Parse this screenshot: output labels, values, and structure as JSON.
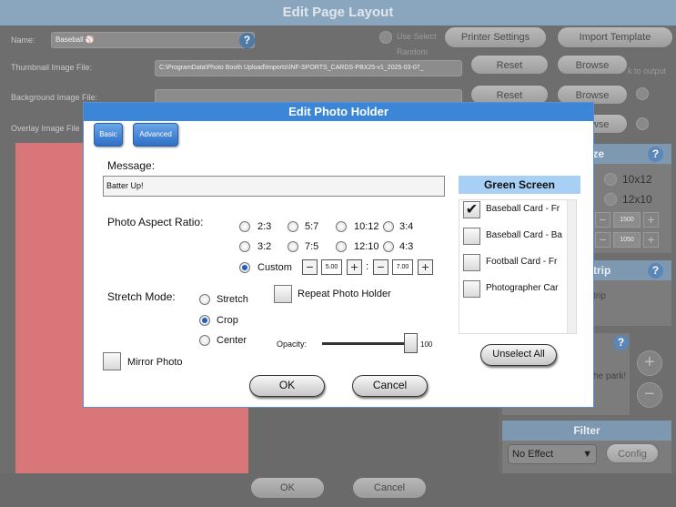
{
  "window": {
    "title": "Edit Page Layout"
  },
  "background": {
    "name_label": "Name:",
    "name_value": "Baseball",
    "thumbnail_label": "Thumbnail Image File:",
    "thumbnail_value": "C:\\ProgramData\\Photo Booth Upload\\Imports\\INF-SPORTS_CARDS-PBX25-v1_2025-03-07_",
    "background_label": "Background Image File:",
    "overlay_label": "Overlay Image File",
    "use_select": "Use Select",
    "random": "Random",
    "to_output": "k to output",
    "printer_settings": "Printer Settings",
    "import_template": "Import Template",
    "reset": "Reset",
    "browse": "Browse",
    "size_header": "ize",
    "size_10x12": "10x12",
    "size_12x10": "12x10",
    "width_value": "1500",
    "height_value": "1050",
    "strip_header": "trip",
    "strip_text": "trip",
    "msg_text": "he park!",
    "filter_header": "Filter",
    "filter_value": "No Effect",
    "config": "Config",
    "ok": "OK",
    "cancel": "Cancel",
    "plus": "+",
    "minus": "−"
  },
  "dialog": {
    "title": "Edit Photo Holder",
    "tabs": {
      "basic": "Basic",
      "advanced": "Advanced"
    },
    "message_label": "Message:",
    "message_value": "Batter Up!",
    "aspect_label": "Photo Aspect Ratio:",
    "aspect_options": [
      "2:3",
      "5:7",
      "10:12",
      "3:4",
      "3:2",
      "7:5",
      "12:10",
      "4:3",
      "Custom"
    ],
    "aspect_selected": "Custom",
    "custom_w": "5.00",
    "custom_h": "7.00",
    "colon": ":",
    "stretch_label": "Stretch Mode:",
    "stretch_options": [
      "Stretch",
      "Crop",
      "Center"
    ],
    "stretch_selected": "Crop",
    "repeat_label": "Repeat Photo Holder",
    "mirror_label": "Mirror Photo",
    "opacity_label": "Opacity:",
    "opacity_value": "100",
    "ok": "OK",
    "cancel": "Cancel",
    "green_screen": {
      "header": "Green Screen",
      "items": [
        {
          "label": "Baseball Card - Fr",
          "checked": true
        },
        {
          "label": "Baseball Card - Ba",
          "checked": false
        },
        {
          "label": "Football Card - Fr",
          "checked": false
        },
        {
          "label": "Photographer Car",
          "checked": false
        }
      ],
      "unselect_all": "Unselect All"
    }
  },
  "colors": {
    "accent": "#3b86d6",
    "canvas_pink": "#d9767a",
    "green_header": "#a8d0f5"
  }
}
